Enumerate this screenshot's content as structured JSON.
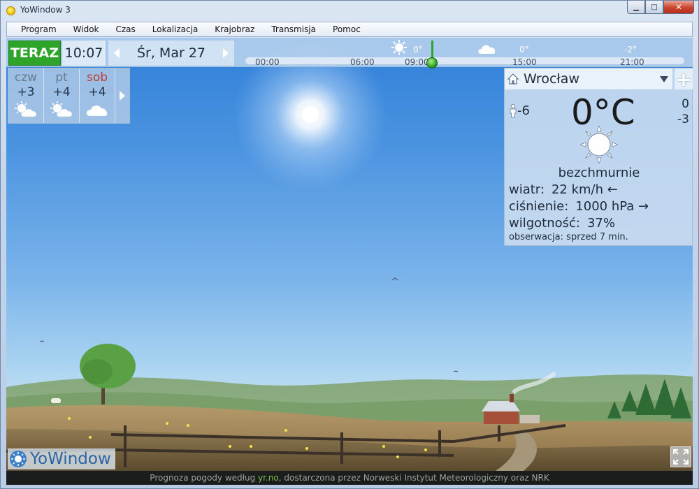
{
  "window": {
    "title": "YoWindow 3",
    "minimize": "▁",
    "maximize": "□",
    "close": "✕"
  },
  "menu": [
    "Program",
    "Widok",
    "Czas",
    "Lokalizacja",
    "Krajobraz",
    "Transmisja",
    "Pomoc"
  ],
  "topbar": {
    "now_label": "TERAZ",
    "time": "10:07",
    "date": "Śr, Mar 27",
    "timeline": {
      "ticks": [
        "00:00",
        "06:00",
        "09:00",
        "15:00",
        "21:00"
      ],
      "temps": [
        "0°",
        "0°",
        "-2°"
      ],
      "icons": [
        "sun-icon",
        "cloud-icon"
      ]
    }
  },
  "forecast": [
    {
      "day": "czw",
      "temp": "+3",
      "icon": "sun-cloud-icon"
    },
    {
      "day": "pt",
      "temp": "+4",
      "icon": "sun-cloud-icon"
    },
    {
      "day": "sob",
      "temp": "+4",
      "icon": "cloud-icon"
    }
  ],
  "current": {
    "location": "Wrocław",
    "temperature": "0°C",
    "feels_like": "-6",
    "max": "0",
    "min": "-3",
    "condition": "bezchmurnie",
    "wind_label": "wiatr:",
    "wind_value": "22 km/h ←",
    "pressure_label": "ciśnienie:",
    "pressure_value": "1000 hPa →",
    "humidity_label": "wilgotność:",
    "humidity_value": "37%",
    "observation_label": "obserwacja:",
    "observation_value": "sprzed 7 min."
  },
  "logo": "YoWindow",
  "status": {
    "prefix": "Prognoza pogody według ",
    "source": "yr.no",
    "suffix": ", dostarczona przez Norweski Instytut Meteorologiczny oraz NRK"
  },
  "colors": {
    "now_green": "#2ea52a",
    "weekend_red": "#c23a2e",
    "sky_top": "#2f7fd9"
  }
}
